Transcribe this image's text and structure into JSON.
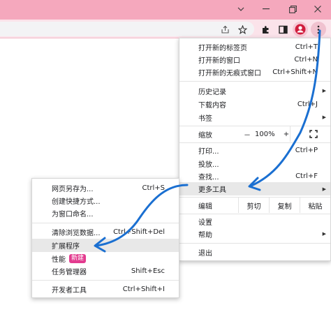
{
  "window": {
    "minimize_icon": "minimize-icon",
    "maximize_icon": "restore-icon",
    "close_icon": "close-icon",
    "chevron_icon": "chevron-down-icon"
  },
  "toolbar": {
    "icons": [
      "share-icon",
      "star-icon",
      "puzzle-icon",
      "sidepanel-icon",
      "profile-icon",
      "kebab-menu-icon"
    ]
  },
  "main_menu": {
    "new_tab": "打开新的标签页",
    "new_tab_sc": "Ctrl+T",
    "new_window": "打开新的窗口",
    "new_window_sc": "Ctrl+N",
    "incognito": "打开新的无痕式窗口",
    "incognito_sc": "Ctrl+Shift+N",
    "history": "历史记录",
    "downloads": "下载内容",
    "downloads_sc": "Ctrl+J",
    "bookmarks": "书签",
    "zoom": "缩放",
    "zoom_minus": "－",
    "zoom_value": "100%",
    "zoom_plus": "+",
    "print": "打印...",
    "print_sc": "Ctrl+P",
    "cast": "投放...",
    "find": "查找...",
    "find_sc": "Ctrl+F",
    "more_tools": "更多工具",
    "edit": "编辑",
    "cut": "剪切",
    "copy": "复制",
    "paste": "粘贴",
    "settings": "设置",
    "help": "帮助",
    "exit": "退出"
  },
  "sub_menu": {
    "save_as": "网页另存为...",
    "save_as_sc": "Ctrl+S",
    "shortcut": "创建快捷方式...",
    "name_window": "为窗口命名...",
    "clear_data": "清除浏览数据...",
    "clear_data_sc": "Ctrl+Shift+Del",
    "extensions": "扩展程序",
    "performance": "性能",
    "new_badge": "新建",
    "task_manager": "任务管理器",
    "task_manager_sc": "Shift+Esc",
    "dev_tools": "开发者工具",
    "dev_tools_sc": "Ctrl+Shift+I"
  },
  "colors": {
    "titlebar": "#f5a8bd",
    "toolbar": "#fbe3ea",
    "highlight": "#e8e8e8",
    "annotation_stroke": "#1a6fd1",
    "badge": "#e33b8f"
  }
}
